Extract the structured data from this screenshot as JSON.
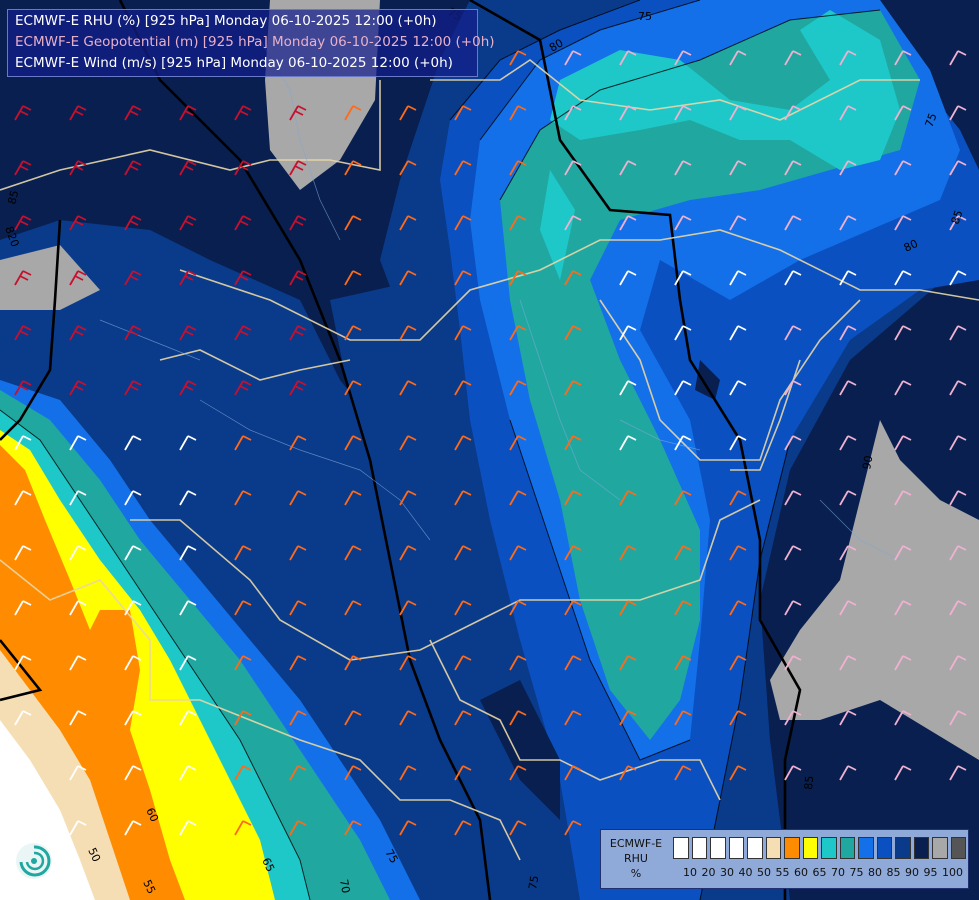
{
  "header": {
    "line1": "ECMWF-E RHU (%) [925 hPa] Monday 06-10-2025 12:00 (+0h)",
    "line2": "ECMWF-E Geopotential (m) [925 hPa] Monday 06-10-2025 12:00 (+0h)",
    "line3": "ECMWF-E Wind (m/s) [925 hPa] Monday 06-10-2025 12:00 (+0h)"
  },
  "legend": {
    "title_line1": "ECMWF-E",
    "title_line2": "RHU",
    "title_line3": "%",
    "colors": [
      "#ffffff",
      "#ffffff",
      "#ffffff",
      "#ffffff",
      "#ffffff",
      "#f5deb3",
      "#ff8c00",
      "#ffff00",
      "#1ec8c8",
      "#20a8a0",
      "#1470e8",
      "#0a50c0",
      "#0a3a8a",
      "#081f50",
      "#a8a8a8",
      "#555555"
    ],
    "ticks": [
      "10",
      "20",
      "30",
      "40",
      "50",
      "55",
      "60",
      "65",
      "70",
      "75",
      "80",
      "85",
      "90",
      "95",
      "100"
    ]
  },
  "contour_labels": [
    "75",
    "80",
    "75",
    "85",
    "80",
    "85",
    "820",
    "90",
    "60",
    "50",
    "55",
    "65",
    "70",
    "75",
    "75",
    "85",
    "75"
  ],
  "colors": {
    "rh_95": "#a8a8a8",
    "rh_90": "#081f50",
    "rh_85": "#0a3a8a",
    "rh_80": "#0a50c0",
    "rh_75": "#1470e8",
    "rh_70": "#20a8a0",
    "rh_65": "#1ec8c8",
    "rh_60": "#ffff00",
    "rh_55": "#ff8c00",
    "rh_50": "#f5deb3"
  },
  "logo_icon": "ecmwf-swirl-logo"
}
